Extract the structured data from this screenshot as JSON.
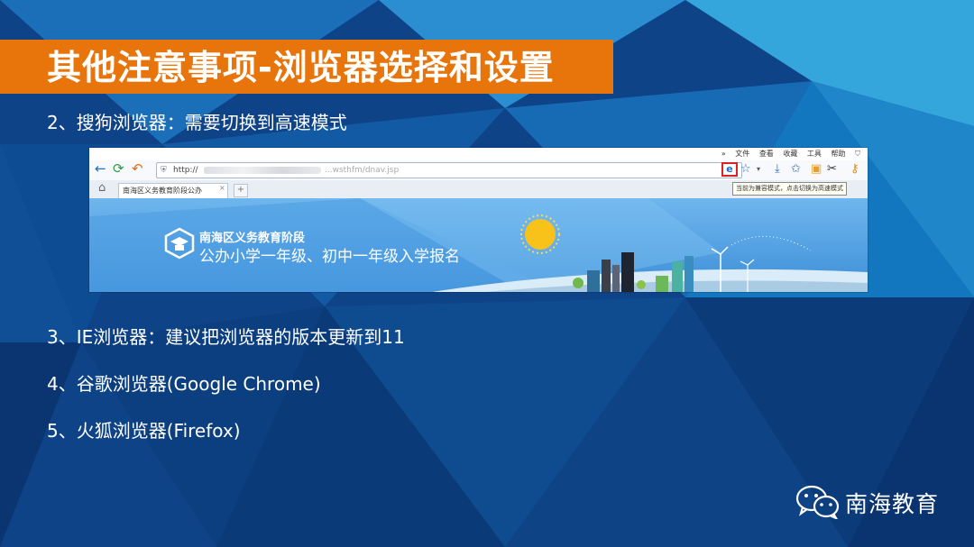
{
  "slide": {
    "title": "其他注意事项-浏览器选择和设置",
    "items": [
      "2、搜狗浏览器：需要切换到高速模式",
      "3、IE浏览器：建议把浏览器的版本更新到11",
      "4、谷歌浏览器(Google Chrome)",
      "5、火狐浏览器(Firefox)"
    ],
    "brand": "南海教育"
  },
  "browser": {
    "menu": [
      "»",
      "文件",
      "查看",
      "收藏",
      "工具",
      "帮助"
    ],
    "url_prefix": "http://",
    "url_suffix": "...wsthfm/dnav.jsp",
    "tab_title": "南海区义务教育阶段公办",
    "tab_close": "×",
    "new_tab": "+",
    "tooltip": "当前为兼容模式，点击切换为高速模式",
    "compat_glyph": "e",
    "banner_line1": "南海区义务教育阶段",
    "banner_line2": "公办小学一年级、初中一年级入学报名"
  },
  "colors": {
    "title_bar": "#e8750c",
    "background": "#0d3f7e",
    "highlight_box": "#e02020",
    "banner_sky": "#5aa7e8"
  }
}
